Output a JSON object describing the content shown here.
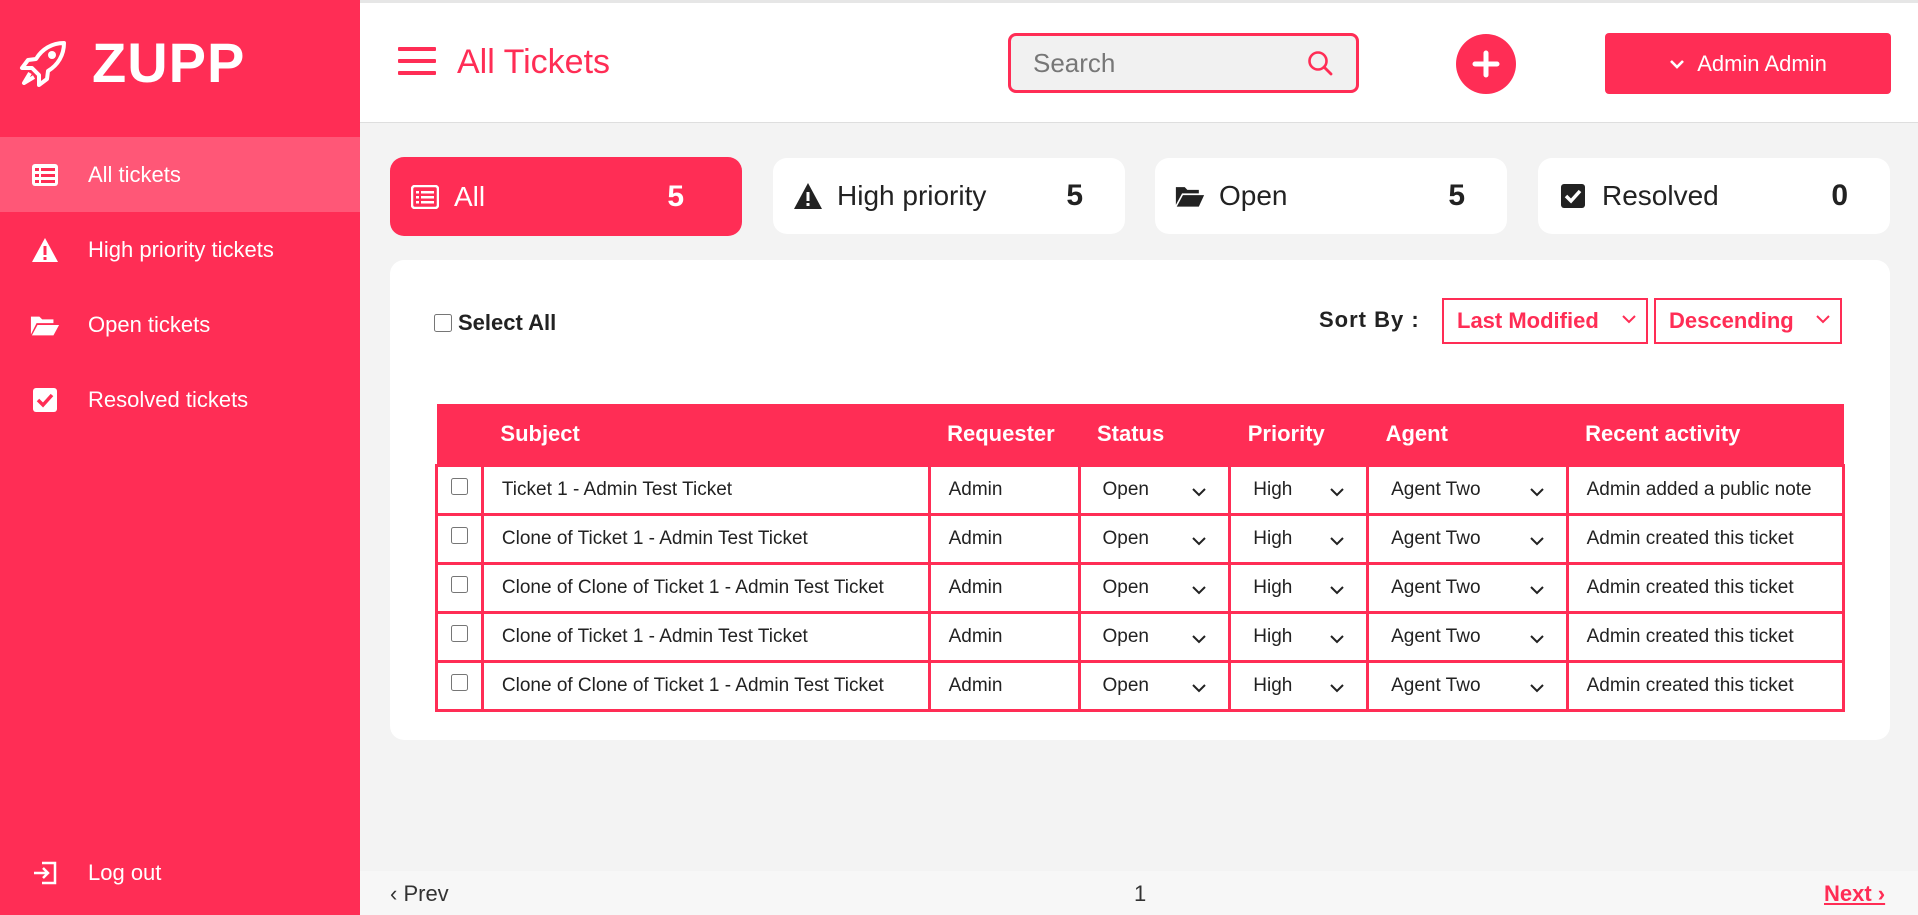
{
  "app": {
    "name": "ZUPP"
  },
  "sidebar": {
    "items": [
      {
        "label": "All tickets",
        "icon": "list-icon",
        "active": true
      },
      {
        "label": "High priority tickets",
        "icon": "warning-icon",
        "active": false
      },
      {
        "label": "Open tickets",
        "icon": "folder-open-icon",
        "active": false
      },
      {
        "label": "Resolved tickets",
        "icon": "check-square-icon",
        "active": false
      }
    ],
    "logout_label": "Log out"
  },
  "header": {
    "title": "All Tickets",
    "search_placeholder": "Search",
    "user_label": "Admin Admin"
  },
  "cards": [
    {
      "label": "All",
      "count": "5",
      "icon": "list-icon",
      "active": true
    },
    {
      "label": "High priority",
      "count": "5",
      "icon": "warning-icon",
      "active": false
    },
    {
      "label": "Open",
      "count": "5",
      "icon": "folder-open-icon",
      "active": false
    },
    {
      "label": "Resolved",
      "count": "0",
      "icon": "check-square-icon",
      "active": false
    }
  ],
  "controls": {
    "select_all_label": "Select All",
    "sort_by_label": "Sort By :",
    "sort_field": "Last Modified",
    "sort_order": "Descending"
  },
  "table": {
    "headers": [
      "",
      "Subject",
      "Requester",
      "Status",
      "Priority",
      "Agent",
      "Recent activity"
    ],
    "rows": [
      {
        "subject": "Ticket 1 - Admin Test Ticket",
        "requester": "Admin",
        "status": "Open",
        "priority": "High",
        "agent": "Agent Two",
        "activity": "Admin added a public note"
      },
      {
        "subject": "Clone of Ticket 1 - Admin Test Ticket",
        "requester": "Admin",
        "status": "Open",
        "priority": "High",
        "agent": "Agent Two",
        "activity": "Admin created this ticket"
      },
      {
        "subject": "Clone of Clone of Ticket 1 - Admin Test Ticket",
        "requester": "Admin",
        "status": "Open",
        "priority": "High",
        "agent": "Agent Two",
        "activity": "Admin created this ticket"
      },
      {
        "subject": "Clone of Ticket 1 - Admin Test Ticket",
        "requester": "Admin",
        "status": "Open",
        "priority": "High",
        "agent": "Agent Two",
        "activity": "Admin created this ticket"
      },
      {
        "subject": "Clone of Clone of Ticket 1 - Admin Test Ticket",
        "requester": "Admin",
        "status": "Open",
        "priority": "High",
        "agent": "Agent Two",
        "activity": "Admin created this ticket"
      }
    ]
  },
  "pager": {
    "prev_label": "‹ Prev",
    "page": "1",
    "next_label": "Next ›"
  },
  "colors": {
    "accent": "#ff2d55",
    "background": "#f3f3f3",
    "panel": "#ffffff"
  }
}
